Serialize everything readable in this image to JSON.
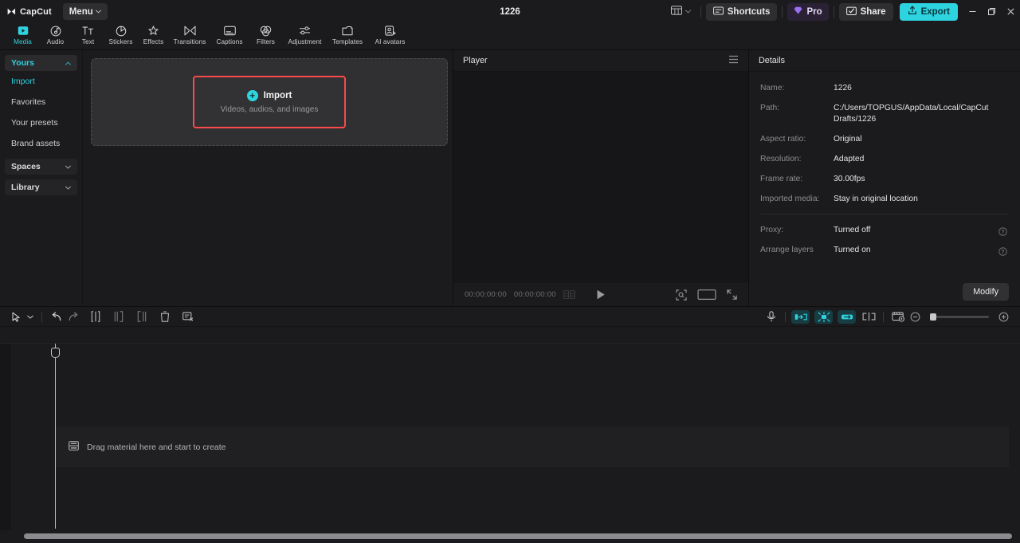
{
  "app": {
    "brand": "CapCut",
    "menu_label": "Menu",
    "project_title": "1226"
  },
  "titlebar": {
    "layout_icon": "layout-switch-icon",
    "shortcuts_label": "Shortcuts",
    "pro_label": "Pro",
    "share_label": "Share",
    "export_label": "Export",
    "minimize": "minimize-icon",
    "maximize": "restore-icon",
    "close": "close-icon",
    "export_color": "#2ed3e0"
  },
  "tabs": [
    {
      "label": "Media",
      "icon": "media-icon",
      "active": true
    },
    {
      "label": "Audio",
      "icon": "audio-icon",
      "active": false
    },
    {
      "label": "Text",
      "icon": "text-icon",
      "active": false
    },
    {
      "label": "Stickers",
      "icon": "stickers-icon",
      "active": false
    },
    {
      "label": "Effects",
      "icon": "effects-icon",
      "active": false
    },
    {
      "label": "Transitions",
      "icon": "transitions-icon",
      "active": false
    },
    {
      "label": "Captions",
      "icon": "captions-icon",
      "active": false
    },
    {
      "label": "Filters",
      "icon": "filters-icon",
      "active": false
    },
    {
      "label": "Adjustment",
      "icon": "adjustment-icon",
      "active": false
    },
    {
      "label": "Templates",
      "icon": "templates-icon",
      "active": false
    },
    {
      "label": "AI avatars",
      "icon": "ai-avatars-icon",
      "active": false
    }
  ],
  "sidebar": {
    "groups": [
      {
        "label": "Yours",
        "expanded": true
      },
      {
        "label": "Spaces",
        "expanded": false
      },
      {
        "label": "Library",
        "expanded": false
      }
    ],
    "items": [
      {
        "label": "Import",
        "selected": true
      },
      {
        "label": "Favorites",
        "selected": false
      },
      {
        "label": "Your presets",
        "selected": false
      },
      {
        "label": "Brand assets",
        "selected": false
      }
    ]
  },
  "media": {
    "import_title": "Import",
    "import_subtitle": "Videos, audios, and images",
    "highlight_color": "#fa4a4a"
  },
  "player": {
    "title": "Player",
    "menu_icon": "hamburger-icon",
    "current_time": "00:00:00:00",
    "total_time": "00:00:00:00",
    "play_icon": "play-icon",
    "ratio_icon": "frame-select-icon",
    "size_icon": "aspect-ratio-icon",
    "fullscreen_icon": "fullscreen-icon"
  },
  "details": {
    "title": "Details",
    "rows": [
      {
        "label": "Name:",
        "value": "1226"
      },
      {
        "label": "Path:",
        "value": "C:/Users/TOPGUS/AppData/Local/CapCut Drafts/1226"
      },
      {
        "label": "Aspect ratio:",
        "value": "Original"
      },
      {
        "label": "Resolution:",
        "value": "Adapted"
      },
      {
        "label": "Frame rate:",
        "value": "30.00fps"
      },
      {
        "label": "Imported media:",
        "value": "Stay in original location"
      }
    ],
    "toggle_rows": [
      {
        "label": "Proxy:",
        "value": "Turned off",
        "help": "help-icon"
      },
      {
        "label": "Arrange layers",
        "value": "Turned on",
        "help": "help-icon"
      }
    ],
    "modify_label": "Modify"
  },
  "timeline": {
    "tools_left": [
      {
        "name": "select-tool-icon"
      },
      {
        "name": "chevron-down-icon"
      },
      {
        "name": "undo-icon"
      },
      {
        "name": "redo-icon"
      },
      {
        "name": "split-icon"
      },
      {
        "name": "trim-left-icon"
      },
      {
        "name": "trim-right-icon"
      },
      {
        "name": "delete-icon"
      },
      {
        "name": "remove-clip-icon"
      }
    ],
    "tools_right": [
      {
        "name": "microphone-icon",
        "on": false
      },
      {
        "name": "snap-to-clip-icon",
        "on": true
      },
      {
        "name": "auto-adsorption-icon",
        "on": true
      },
      {
        "name": "link-clips-icon",
        "on": true
      },
      {
        "name": "split-preview-icon",
        "on": false
      },
      {
        "name": "thumbnail-settings-icon",
        "on": false
      },
      {
        "name": "zoom-out-icon",
        "on": false
      },
      {
        "name": "zoom-slider",
        "on": false
      },
      {
        "name": "zoom-in-icon",
        "on": false
      }
    ],
    "placeholder_text": "Drag material here and start to create",
    "placeholder_icon": "track-icon"
  }
}
